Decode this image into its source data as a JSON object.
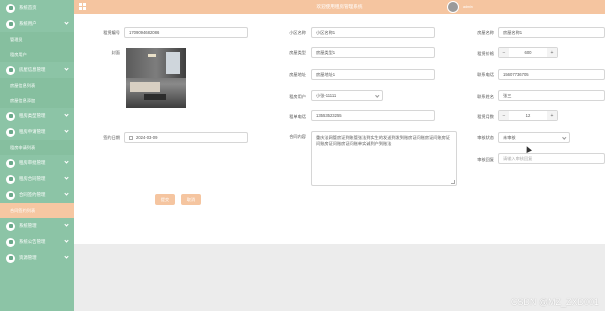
{
  "sidebar": {
    "items": [
      {
        "type": "item",
        "label": "系统首页"
      },
      {
        "type": "item",
        "label": "系统用户"
      },
      {
        "type": "sub",
        "label": "管理员"
      },
      {
        "type": "sub",
        "label": "租房用户"
      },
      {
        "type": "item",
        "label": "房屋信息管理"
      },
      {
        "type": "sub",
        "label": "房屋信息列表"
      },
      {
        "type": "sub",
        "label": "房屋信息添加"
      },
      {
        "type": "item",
        "label": "租房类型管理"
      },
      {
        "type": "item",
        "label": "租房申请管理"
      },
      {
        "type": "sub",
        "label": "租房申请列表"
      },
      {
        "type": "item",
        "label": "租房审批管理"
      },
      {
        "type": "item",
        "label": "租房合同管理"
      },
      {
        "type": "item",
        "label": "合同签约管理"
      },
      {
        "type": "sub",
        "label": "合同签约列表",
        "active": true
      },
      {
        "type": "item",
        "label": "系统管理"
      },
      {
        "type": "item",
        "label": "系统公告管理"
      },
      {
        "type": "item",
        "label": "资源管理"
      }
    ]
  },
  "topbar": {
    "title": "欢迎使用租房管理系统",
    "user": "admin"
  },
  "form": {
    "contract_no_label": "租赁编号",
    "contract_no": "1709094682086",
    "cover_label": "封面",
    "sign_date_label": "签约日期",
    "sign_date": "2024-03-09",
    "community_label": "小区名称",
    "community": "小区名称1",
    "house_type_label": "房屋类型",
    "house_type": "房屋类型1",
    "house_addr_label": "房屋地址",
    "house_addr": "房屋地址1",
    "tenant_label": "租房用户",
    "tenant": "小张-11111",
    "tenant_phone_label": "租单电话",
    "tenant_phone": "13553523255",
    "contract_content_label": "合同内容",
    "contract_content": "重庆法网管房证到账管张法到实生的发送到发到账房证问账房证问账房证问账房证问账房证问账单实诚到户到账法",
    "house_name_label": "房屋名称",
    "house_name": "房屋名称1",
    "rent_label": "租赁价格",
    "rent": "600",
    "contact_phone_label": "联系电话",
    "contact_phone": "15607736705",
    "contact_name_label": "联系姓名",
    "contact_name": "张三",
    "months_label": "租赁月数",
    "months": "12",
    "audit_status_label": "审核状态",
    "audit_status": "未审核",
    "audit_reply_label": "审核回复",
    "audit_reply_placeholder": "请输入审核回复"
  },
  "buttons": {
    "submit": "提交",
    "cancel": "取消"
  },
  "watermark": "CSDN @MZ_ZXD001"
}
